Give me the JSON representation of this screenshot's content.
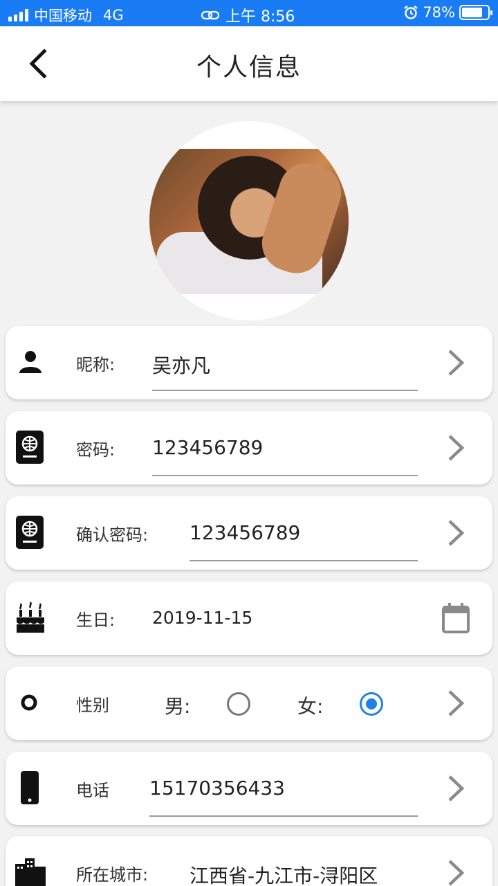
{
  "status_bar": {
    "carrier": "中国移动",
    "network": "4G",
    "time": "上午 8:56",
    "battery": "78%",
    "battery_level": 0.78,
    "colors": {
      "bar_bg": "#1a7cf5"
    }
  },
  "header": {
    "title": "个人信息",
    "back_icon": "chevron-left-icon"
  },
  "avatar": {
    "icon": "profile-photo"
  },
  "fields": {
    "nickname": {
      "label": "昵称:",
      "value": "吴亦凡",
      "icon": "person-icon"
    },
    "password": {
      "label": "密码:",
      "value": "123456789",
      "icon": "passport-icon"
    },
    "confirm_password": {
      "label": "确认密码:",
      "value": "123456789",
      "icon": "passport-icon"
    },
    "birthday": {
      "label": "生日:",
      "value": "2019-11-15",
      "icon": "cake-icon",
      "action_icon": "calendar-icon"
    },
    "gender": {
      "label": "性别",
      "male_label": "男:",
      "female_label": "女:",
      "selected": "female",
      "icon": "radio-dot-icon"
    },
    "phone": {
      "label": "电话",
      "value": "15170356433",
      "icon": "smartphone-icon"
    },
    "city": {
      "label": "所在城市:",
      "value": "江西省-九江市-浔阳区",
      "icon": "city-icon"
    }
  },
  "colors": {
    "accent": "#1e80f0",
    "chevron": "#8a8a8a"
  }
}
